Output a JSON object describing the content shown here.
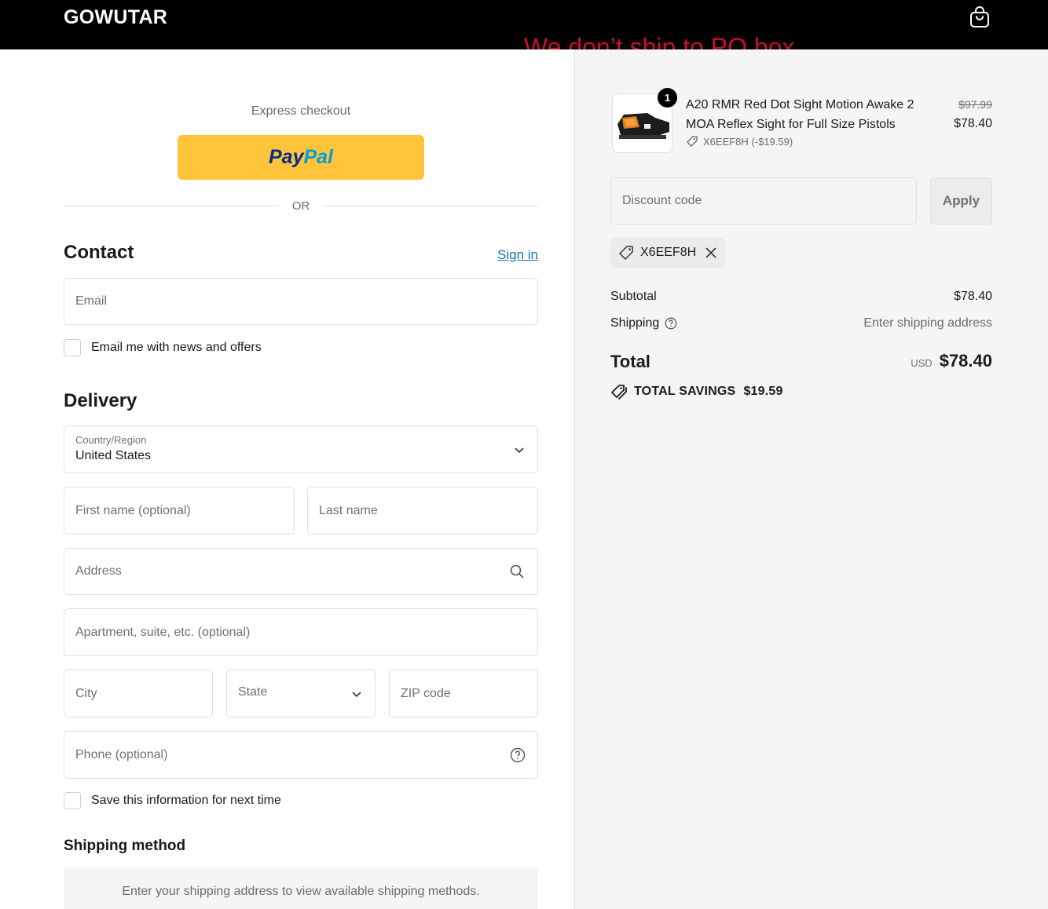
{
  "header": {
    "brand": "GOWUTAR",
    "banner": "We don’t ship to PO box",
    "cart_icon": "shopping-bag-icon"
  },
  "express": {
    "label": "Express checkout",
    "paypal_pay": "Pay",
    "paypal_pal": "Pal",
    "or": "OR"
  },
  "contact": {
    "heading": "Contact",
    "sign_in": "Sign in",
    "email_placeholder": "Email",
    "newsletter_label": "Email me with news and offers"
  },
  "delivery": {
    "heading": "Delivery",
    "country_label": "Country/Region",
    "country_value": "United States",
    "first_name_placeholder": "First name (optional)",
    "last_name_placeholder": "Last name",
    "address_placeholder": "Address",
    "apartment_placeholder": "Apartment, suite, etc. (optional)",
    "city_placeholder": "City",
    "state_placeholder": "State",
    "zip_placeholder": "ZIP code",
    "phone_placeholder": "Phone (optional)",
    "save_label": "Save this information for next time"
  },
  "shipping_method": {
    "heading": "Shipping method",
    "message": "Enter your shipping address to view available shipping methods."
  },
  "order": {
    "product": {
      "quantity": "1",
      "title": "A20 RMR Red Dot Sight Motion Awake 2 MOA Reflex Sight for Full Size Pistols",
      "discount_line": "X6EEF8H (-$19.59)",
      "original_price": "$97.99",
      "price": "$78.40"
    },
    "discount_placeholder": "Discount code",
    "apply_label": "Apply",
    "applied_code": "X6EEF8H",
    "subtotal_label": "Subtotal",
    "subtotal_value": "$78.40",
    "shipping_label": "Shipping",
    "shipping_value": "Enter shipping address",
    "total_label": "Total",
    "currency": "USD",
    "total_value": "$78.40",
    "savings_label": "TOTAL SAVINGS",
    "savings_value": "$19.59"
  },
  "colors": {
    "paypal_yellow": "#ffc439",
    "link_blue": "#1773b0",
    "banner_red": "#c8102e",
    "summary_bg": "#f5f5f5"
  }
}
